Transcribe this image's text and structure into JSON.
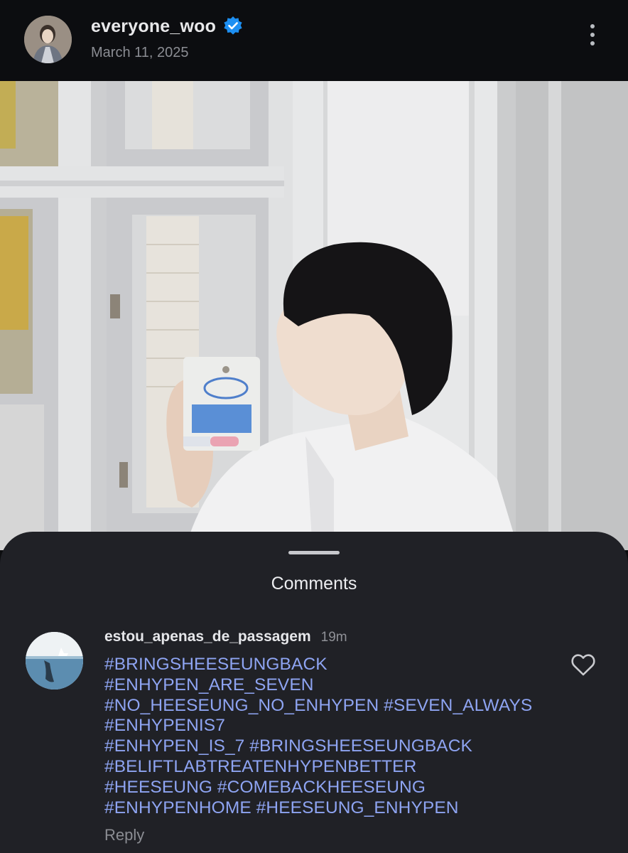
{
  "post": {
    "username": "everyone_woo",
    "date": "March 11, 2025"
  },
  "comments_sheet": {
    "title": "Comments",
    "comment": {
      "username": "estou_apenas_de_passagem",
      "time": "19m",
      "text_lines": [
        "#BRINGSHEESEUNGBACK",
        "#ENHYPEN_ARE_SEVEN",
        "#NO_HEESEUNG_NO_ENHYPEN #SEVEN_ALWAYS",
        "#ENHYPENIS7",
        "#ENHYPEN_IS_7 #BRINGSHEESEUNGBACK",
        "#BELIFTLABTREATENHYPENBETTER",
        "#HEESEUNG #COMEBACKHEESEUNG",
        "#ENHYPENHOME #HEESEUNG_ENHYPEN"
      ],
      "reply_label": "Reply"
    }
  },
  "icons": {
    "verified": "verified-badge-icon",
    "more": "more-vertical-icon",
    "like": "heart-outline-icon"
  },
  "colors": {
    "background": "#0c0d10",
    "sheet": "#202126",
    "hashtag": "#8ea4f2",
    "verified": "#1d8ff2"
  }
}
